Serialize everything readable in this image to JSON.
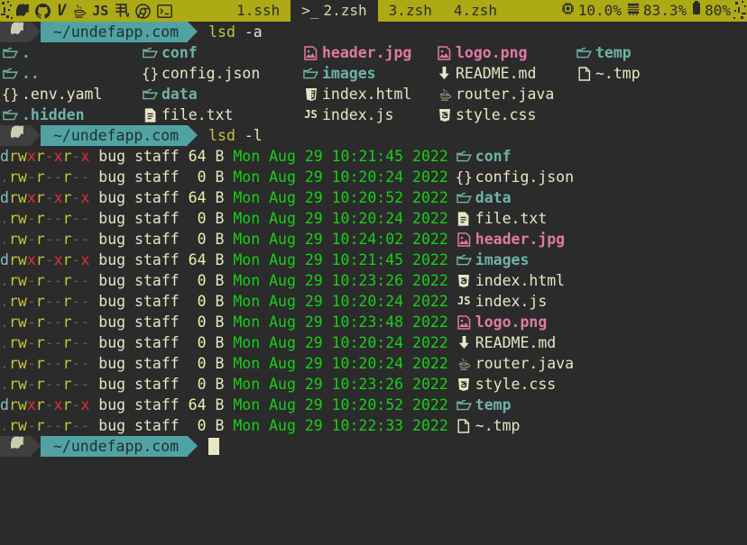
{
  "topbar": {
    "background": "#adaa16",
    "icons": [
      {
        "name": "circuit-icon",
        "glyph": "circuit"
      },
      {
        "name": "apple-icon",
        "glyph": "apple"
      },
      {
        "name": "github-octocat-icon",
        "glyph": "octocat"
      },
      {
        "name": "vim-icon",
        "glyph": "V"
      },
      {
        "name": "java-icon",
        "glyph": "coffee"
      },
      {
        "name": "javascript-icon",
        "glyph": "JS"
      },
      {
        "name": "cjk-icon",
        "glyph": "丮"
      },
      {
        "name": "chrome-icon",
        "glyph": "chrome"
      },
      {
        "name": "terminal-icon",
        "glyph": "terminal"
      }
    ],
    "tabs": [
      {
        "label": "1.ssh",
        "active": false,
        "prefix": ""
      },
      {
        "label": "2.zsh",
        "active": true,
        "prefix": ">_"
      },
      {
        "label": "3.zsh",
        "active": false,
        "prefix": ""
      },
      {
        "label": "4.zsh",
        "active": false,
        "prefix": ""
      }
    ],
    "stats": [
      {
        "name": "cpu",
        "icon": "cpu-icon",
        "value": "10.0%"
      },
      {
        "name": "memory",
        "icon": "memory-icon",
        "value": "83.3%"
      },
      {
        "name": "battery",
        "icon": "battery-icon",
        "value": "80%"
      }
    ]
  },
  "prompt": {
    "apple_glyph": "apple",
    "path": "~/undefapp.com",
    "path_bg": "#51a3a3",
    "apple_bg": "#3f3f3f"
  },
  "commands": {
    "first": {
      "cmd": "lsd",
      "args": "-a"
    },
    "second": {
      "cmd": "lsd",
      "args": "-l"
    }
  },
  "listing_a": {
    "columns": [
      [
        {
          "icon": "folder-icon",
          "name": ".",
          "type": "dir"
        },
        {
          "icon": "folder-icon",
          "name": "..",
          "type": "dir"
        },
        {
          "icon": "json-icon",
          "name": ".env.yaml",
          "type": "file"
        },
        {
          "icon": "folder-icon",
          "name": ".hidden",
          "type": "dir"
        }
      ],
      [
        {
          "icon": "folder-icon",
          "name": "conf",
          "type": "dir"
        },
        {
          "icon": "json-icon",
          "name": "config.json",
          "type": "file"
        },
        {
          "icon": "folder-icon",
          "name": "data",
          "type": "dir"
        },
        {
          "icon": "document-icon",
          "name": "file.txt",
          "type": "file"
        }
      ],
      [
        {
          "icon": "image-icon",
          "name": "header.jpg",
          "type": "img"
        },
        {
          "icon": "folder-icon",
          "name": "images",
          "type": "dir"
        },
        {
          "icon": "html5-icon",
          "name": "index.html",
          "type": "file"
        },
        {
          "icon": "js-icon",
          "name": "index.js",
          "type": "file"
        }
      ],
      [
        {
          "icon": "image-icon",
          "name": "logo.png",
          "type": "img"
        },
        {
          "icon": "markdown-icon",
          "name": "README.md",
          "type": "file"
        },
        {
          "icon": "java-icon",
          "name": "router.java",
          "type": "file"
        },
        {
          "icon": "css3-icon",
          "name": "style.css",
          "type": "file"
        }
      ],
      [
        {
          "icon": "folder-icon",
          "name": "temp",
          "type": "dir"
        },
        {
          "icon": "blankfile-icon",
          "name": "~.tmp",
          "type": "file"
        }
      ]
    ]
  },
  "listing_l": {
    "rows": [
      {
        "perm": "drwxr-xr-x",
        "user": "bug",
        "group": "staff",
        "size": "64",
        "unit": "B",
        "dow": "Mon",
        "month": "Aug",
        "day": "29",
        "time": "10:21:45",
        "year": "2022",
        "icon": "folder-icon",
        "name": "conf",
        "type": "dir"
      },
      {
        "perm": ".rw-r--r--",
        "user": "bug",
        "group": "staff",
        "size": "0",
        "unit": "B",
        "dow": "Mon",
        "month": "Aug",
        "day": "29",
        "time": "10:20:24",
        "year": "2022",
        "icon": "json-icon",
        "name": "config.json",
        "type": "file"
      },
      {
        "perm": "drwxr-xr-x",
        "user": "bug",
        "group": "staff",
        "size": "64",
        "unit": "B",
        "dow": "Mon",
        "month": "Aug",
        "day": "29",
        "time": "10:20:52",
        "year": "2022",
        "icon": "folder-icon",
        "name": "data",
        "type": "dir"
      },
      {
        "perm": ".rw-r--r--",
        "user": "bug",
        "group": "staff",
        "size": "0",
        "unit": "B",
        "dow": "Mon",
        "month": "Aug",
        "day": "29",
        "time": "10:20:24",
        "year": "2022",
        "icon": "document-icon",
        "name": "file.txt",
        "type": "file"
      },
      {
        "perm": ".rw-r--r--",
        "user": "bug",
        "group": "staff",
        "size": "0",
        "unit": "B",
        "dow": "Mon",
        "month": "Aug",
        "day": "29",
        "time": "10:24:02",
        "year": "2022",
        "icon": "image-icon",
        "name": "header.jpg",
        "type": "img"
      },
      {
        "perm": "drwxr-xr-x",
        "user": "bug",
        "group": "staff",
        "size": "64",
        "unit": "B",
        "dow": "Mon",
        "month": "Aug",
        "day": "29",
        "time": "10:21:45",
        "year": "2022",
        "icon": "folder-icon",
        "name": "images",
        "type": "dir"
      },
      {
        "perm": ".rw-r--r--",
        "user": "bug",
        "group": "staff",
        "size": "0",
        "unit": "B",
        "dow": "Mon",
        "month": "Aug",
        "day": "29",
        "time": "10:23:26",
        "year": "2022",
        "icon": "html5-icon",
        "name": "index.html",
        "type": "file"
      },
      {
        "perm": ".rw-r--r--",
        "user": "bug",
        "group": "staff",
        "size": "0",
        "unit": "B",
        "dow": "Mon",
        "month": "Aug",
        "day": "29",
        "time": "10:20:24",
        "year": "2022",
        "icon": "js-icon",
        "name": "index.js",
        "type": "file"
      },
      {
        "perm": ".rw-r--r--",
        "user": "bug",
        "group": "staff",
        "size": "0",
        "unit": "B",
        "dow": "Mon",
        "month": "Aug",
        "day": "29",
        "time": "10:23:48",
        "year": "2022",
        "icon": "image-icon",
        "name": "logo.png",
        "type": "img"
      },
      {
        "perm": ".rw-r--r--",
        "user": "bug",
        "group": "staff",
        "size": "0",
        "unit": "B",
        "dow": "Mon",
        "month": "Aug",
        "day": "29",
        "time": "10:20:24",
        "year": "2022",
        "icon": "markdown-icon",
        "name": "README.md",
        "type": "file"
      },
      {
        "perm": ".rw-r--r--",
        "user": "bug",
        "group": "staff",
        "size": "0",
        "unit": "B",
        "dow": "Mon",
        "month": "Aug",
        "day": "29",
        "time": "10:20:24",
        "year": "2022",
        "icon": "java-icon",
        "name": "router.java",
        "type": "file"
      },
      {
        "perm": ".rw-r--r--",
        "user": "bug",
        "group": "staff",
        "size": "0",
        "unit": "B",
        "dow": "Mon",
        "month": "Aug",
        "day": "29",
        "time": "10:23:26",
        "year": "2022",
        "icon": "css3-icon",
        "name": "style.css",
        "type": "file"
      },
      {
        "perm": "drwxr-xr-x",
        "user": "bug",
        "group": "staff",
        "size": "64",
        "unit": "B",
        "dow": "Mon",
        "month": "Aug",
        "day": "29",
        "time": "10:20:52",
        "year": "2022",
        "icon": "folder-icon",
        "name": "temp",
        "type": "dir"
      },
      {
        "perm": ".rw-r--r--",
        "user": "bug",
        "group": "staff",
        "size": "0",
        "unit": "B",
        "dow": "Mon",
        "month": "Aug",
        "day": "29",
        "time": "10:22:33",
        "year": "2022",
        "icon": "blankfile-icon",
        "name": "~.tmp",
        "type": "file"
      }
    ]
  },
  "colors": {
    "background": "#2b2b2b",
    "topbar": "#adaa16",
    "dir": "#6fb3a8",
    "file": "#e8e6c4",
    "image": "#e07aa5",
    "date": "#17cf17",
    "perm_rw": "#c8c43a",
    "perm_x": "#e03030",
    "path_segment": "#51a3a3"
  }
}
